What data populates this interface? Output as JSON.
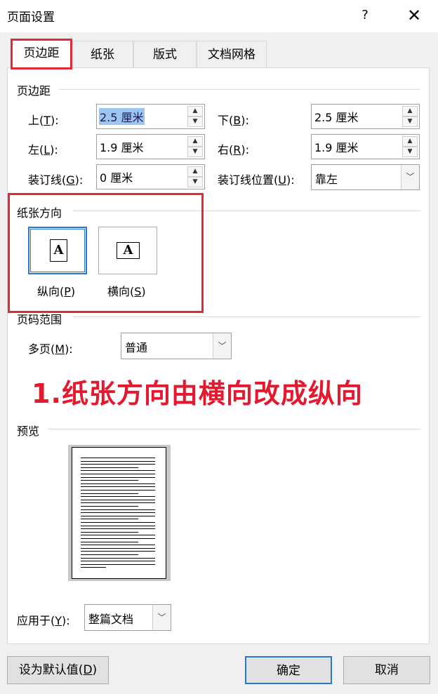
{
  "window": {
    "title": "页面设置",
    "help": "?",
    "close": "✕"
  },
  "tabs": [
    "页边距",
    "纸张",
    "版式",
    "文档网格"
  ],
  "margins": {
    "group_title": "页边距",
    "top_label": "上(",
    "top_key": "T",
    "top_suffix": "):",
    "top_value": "2.5 厘米",
    "bottom_label": "下(",
    "bottom_key": "B",
    "bottom_suffix": "):",
    "bottom_value": "2.5 厘米",
    "left_label": "左(",
    "left_key": "L",
    "left_suffix": "):",
    "left_value": "1.9 厘米",
    "right_label": "右(",
    "right_key": "R",
    "right_suffix": "):",
    "right_value": "1.9 厘米",
    "gutter_label": "装订线(",
    "gutter_key": "G",
    "gutter_suffix": "):",
    "gutter_value": "0 厘米",
    "gutter_pos_label": "装订线位置(",
    "gutter_pos_key": "U",
    "gutter_pos_suffix": "):",
    "gutter_pos_value": "靠左"
  },
  "orientation": {
    "group_title": "纸张方向",
    "portrait_label": "纵向(",
    "portrait_key": "P",
    "portrait_suffix": ")",
    "landscape_label": "横向(",
    "landscape_key": "S",
    "landscape_suffix": ")",
    "icon_letter": "A",
    "selected": "portrait"
  },
  "pages": {
    "group_title": "页码范围",
    "multi_label": "多页(",
    "multi_key": "M",
    "multi_suffix": "):",
    "multi_value": "普通"
  },
  "annotation": "1.纸张方向由横向改成纵向",
  "preview": {
    "group_title": "预览"
  },
  "apply": {
    "label": "应用于(",
    "key": "Y",
    "suffix": "):",
    "value": "整篇文档"
  },
  "buttons": {
    "default_label": "设为默认值(",
    "default_key": "D",
    "default_suffix": ")",
    "ok": "确定",
    "cancel": "取消"
  },
  "colors": {
    "highlight": "#e02a35",
    "accent": "#2c76d2",
    "selection": "#9cc6ef"
  }
}
